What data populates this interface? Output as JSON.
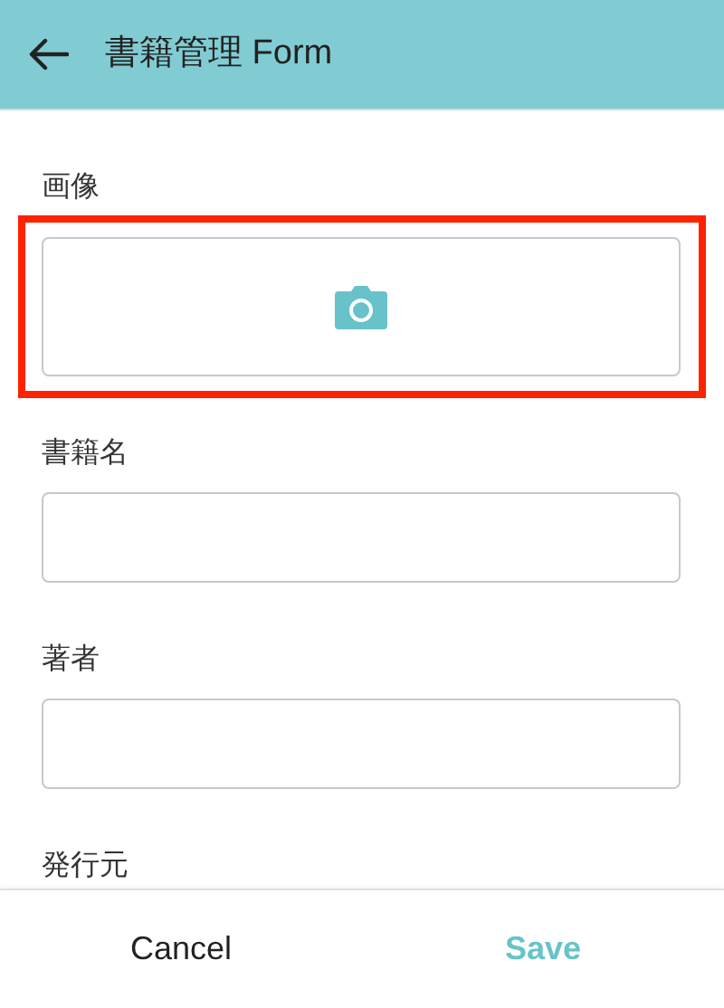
{
  "header": {
    "title": "書籍管理 Form"
  },
  "fields": [
    {
      "kind": "photo",
      "label": "画像",
      "highlighted": true
    },
    {
      "kind": "text",
      "label": "書籍名"
    },
    {
      "kind": "text",
      "label": "著者"
    },
    {
      "kind": "label",
      "label": "発行元"
    }
  ],
  "footer": {
    "cancel": "Cancel",
    "save": "Save"
  }
}
